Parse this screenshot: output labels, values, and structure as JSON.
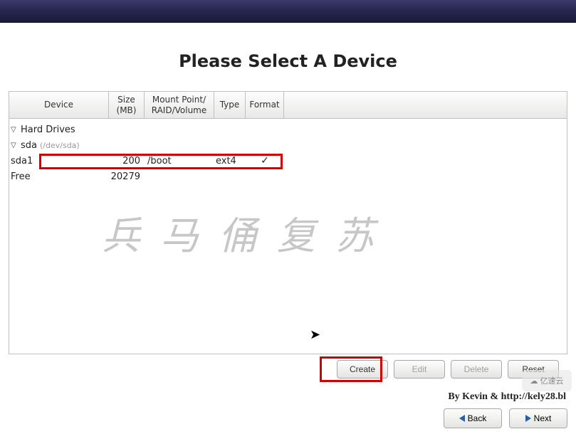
{
  "title": "Please Select A Device",
  "headers": {
    "device": "Device",
    "size": "Size\n(MB)",
    "mount": "Mount Point/\nRAID/Volume",
    "type": "Type",
    "format": "Format"
  },
  "tree": {
    "root_label": "Hard Drives",
    "disk": {
      "name": "sda",
      "path": "(/dev/sda)"
    },
    "partitions": [
      {
        "name": "sda1",
        "size": "200",
        "mount": "/boot",
        "type": "ext4",
        "format": "✓"
      },
      {
        "name": "Free",
        "size": "20279",
        "mount": "",
        "type": "",
        "format": ""
      }
    ]
  },
  "buttons": {
    "create": "Create",
    "edit": "Edit",
    "delete": "Delete",
    "reset": "Reset"
  },
  "nav": {
    "back": "Back",
    "next": "Next"
  },
  "watermark": "兵马俑复苏",
  "attribution": "By Kevin & http://kely28.bl",
  "corner": "亿速云"
}
